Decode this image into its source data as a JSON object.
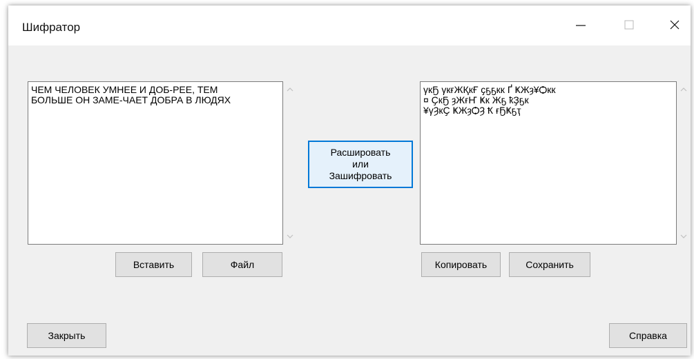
{
  "window": {
    "title": "Шифратор"
  },
  "input_text": {
    "value": "ЧЕМ ЧЕЛОВЕК УМНЕЕ И ДОБ-РЕЕ, ТЕМ\nБОЛЬШЕ ОН ЗАМЕ-ЧАЕТ ДОБРА В ЛЮДЯХ"
  },
  "output_text": {
    "value": "γкҔ γкғЖҚкҒ ҫҕҕкк Ґ ҜЖȝ¥Ѻкк\n¤ ҪкҔ ȝЖғҤ Ҝк Жҕ ҟҘҕк\n¥γȜкҪ ҜЖȝѺȜ Ҟ ғҔҜҕҭ"
  },
  "buttons": {
    "paste": "Вставить",
    "file": "Файл",
    "crypt": "Расшировать\nили\nЗашифровать",
    "copy": "Копировать",
    "save": "Сохранить",
    "close": "Закрыть",
    "help": "Справка"
  },
  "icons": {
    "minimize": "minimize-icon",
    "maximize": "maximize-icon",
    "close": "close-icon",
    "scroll_up": "chevron-up-icon",
    "scroll_down": "chevron-down-icon"
  },
  "colors": {
    "accent": "#0078d7",
    "window_bg": "#f0f0f0",
    "titlebar_bg": "#ffffff",
    "button_bg": "#e1e1e1"
  }
}
